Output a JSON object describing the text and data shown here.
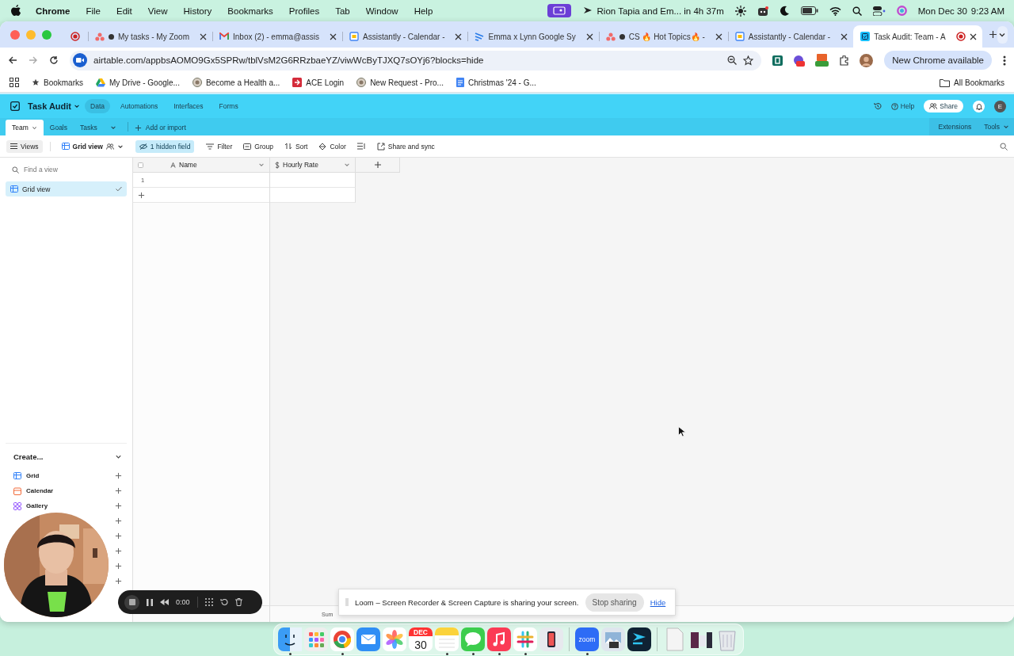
{
  "menubar": {
    "app": "Chrome",
    "menus": [
      "File",
      "Edit",
      "View",
      "History",
      "Bookmarks",
      "Profiles",
      "Tab",
      "Window",
      "Help"
    ],
    "meeting": "Rion Tapia and Em... in 4h 37m",
    "date": "Mon Dec 30",
    "time": "9:23 AM"
  },
  "browser": {
    "tabs": [
      {
        "kind": "record",
        "selected": false
      },
      {
        "kind": "dots",
        "title": "My tasks - My Zoom",
        "dot": true,
        "selected": false
      },
      {
        "kind": "mail",
        "title": "Inbox (2) - emma@assis",
        "selected": false
      },
      {
        "kind": "calendar",
        "title": "Assistantly - Calendar -",
        "selected": false
      },
      {
        "kind": "stripes",
        "title": "Emma x Lynn Google Sy",
        "selected": false
      },
      {
        "kind": "dots",
        "title": "CS 🔥 Hot Topics🔥 -",
        "dot": true,
        "selected": false
      },
      {
        "kind": "calendar",
        "title": "Assistantly - Calendar -",
        "selected": false
      },
      {
        "kind": "check",
        "title": "Task Audit: Team - A",
        "recording": true,
        "selected": true
      }
    ],
    "address": "airtable.com/appbsAOMO9Gx5SPRw/tblVsM2G6RRzbaeYZ/viwWcByTJXQ7sOYj6?blocks=hide",
    "update_button": "New Chrome available",
    "bookmarks": [
      {
        "kind": "star",
        "label": "Bookmarks"
      },
      {
        "kind": "drive",
        "label": "My Drive - Google..."
      },
      {
        "kind": "seal",
        "label": "Become a Health a..."
      },
      {
        "kind": "arrow",
        "label": "ACE Login"
      },
      {
        "kind": "seal",
        "label": "New Request - Pro..."
      },
      {
        "kind": "doc",
        "label": "Christmas '24 - G..."
      }
    ],
    "all_bookmarks": "All Bookmarks"
  },
  "app": {
    "base": "Task Audit",
    "nav": [
      {
        "label": "Data",
        "selected": true
      },
      {
        "label": "Automations",
        "selected": false
      },
      {
        "label": "Interfaces",
        "selected": false
      },
      {
        "label": "Forms",
        "selected": false
      }
    ],
    "help": "Help",
    "share": "Share",
    "avatar": "E",
    "tables": [
      {
        "label": "Team",
        "selected": true
      },
      {
        "label": "Goals",
        "selected": false
      },
      {
        "label": "Tasks",
        "selected": false
      }
    ],
    "add_table": "Add or import",
    "extensions": "Extensions",
    "tools": "Tools",
    "toolbar": {
      "views": "Views",
      "view_name": "Grid view",
      "hidden": "1 hidden field",
      "actions": [
        {
          "kind": "filter",
          "label": "Filter"
        },
        {
          "kind": "group",
          "label": "Group"
        },
        {
          "kind": "sort",
          "label": "Sort"
        },
        {
          "kind": "color",
          "label": "Color"
        },
        {
          "kind": "height"
        },
        {
          "kind": "share",
          "label": "Share and sync"
        }
      ]
    },
    "sidebar": {
      "search_placeholder": "Find a view",
      "views": [
        {
          "label": "Grid view",
          "selected": true
        }
      ],
      "create_title": "Create...",
      "create_items": [
        {
          "kind": "grid",
          "label": "Grid"
        },
        {
          "kind": "calendar",
          "label": "Calendar"
        },
        {
          "kind": "gallery",
          "label": "Gallery"
        },
        {
          "kind": "covered"
        },
        {
          "kind": "covered"
        },
        {
          "kind": "covered"
        },
        {
          "kind": "covered"
        },
        {
          "kind": "covered"
        }
      ]
    },
    "grid": {
      "columns": [
        {
          "kind": "text",
          "name": "Name"
        },
        {
          "kind": "currency",
          "name": "Hourly Rate"
        }
      ],
      "rows": [
        {
          "number": "1"
        }
      ],
      "summary": "Sum"
    }
  },
  "loom": {
    "timer": "0:00",
    "message": "Loom – Screen Recorder & Screen Capture is sharing your screen.",
    "stop": "Stop sharing",
    "hide": "Hide"
  },
  "dock": [
    {
      "kind": "finder",
      "running": true
    },
    {
      "kind": "launchpad",
      "running": false
    },
    {
      "kind": "chrome",
      "running": true
    },
    {
      "kind": "mail",
      "running": false
    },
    {
      "kind": "photos",
      "running": false
    },
    {
      "kind": "calendar",
      "month": "DEC",
      "day": "30",
      "running": false
    },
    {
      "kind": "notes",
      "running": true
    },
    {
      "kind": "messages",
      "running": true
    },
    {
      "kind": "music",
      "running": true
    },
    {
      "kind": "slack",
      "running": true
    },
    {
      "kind": "phone",
      "running": false
    },
    {
      "kind": "divider"
    },
    {
      "kind": "zoom",
      "label": "zoom",
      "running": true
    },
    {
      "kind": "preview",
      "running": false
    },
    {
      "kind": "arrowapp",
      "running": false
    },
    {
      "kind": "divider"
    },
    {
      "kind": "file",
      "running": false
    },
    {
      "kind": "stack",
      "running": false
    },
    {
      "kind": "trash",
      "running": false
    }
  ]
}
